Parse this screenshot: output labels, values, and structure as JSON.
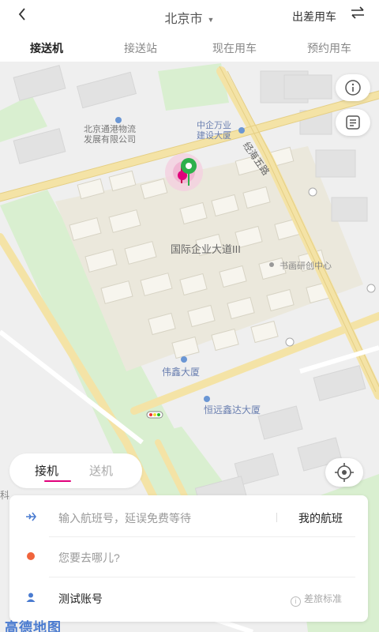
{
  "header": {
    "back_icon": "chevron-left-icon",
    "city": "北京市",
    "business_trip": "出差用车",
    "swap_icon": "swap-icon"
  },
  "tabs": [
    {
      "label": "接送机",
      "active": true
    },
    {
      "label": "接送站",
      "active": false
    },
    {
      "label": "现在用车",
      "active": false
    },
    {
      "label": "预约用车",
      "active": false
    }
  ],
  "map": {
    "labels": {
      "company1": [
        "北京通港物流",
        "发展有限公司"
      ],
      "company2": [
        "中企万业",
        "建设大厦"
      ],
      "road": "经海五路",
      "plaza": "国际企业大道III",
      "center": "书画研创中心",
      "weixin": "伟鑫大厦",
      "hengyuan": "恒远鑫达大厦",
      "edge": "科"
    },
    "brand_logo": "高德地图"
  },
  "mode_tabs": [
    {
      "label": "接机",
      "active": true
    },
    {
      "label": "送机",
      "active": false
    }
  ],
  "form": {
    "flight_placeholder": "输入航班号，延误免费等待",
    "my_flight": "我的航班",
    "destination_placeholder": "您要去哪儿?",
    "account": "测试账号",
    "travel_standard": "差旅标准"
  },
  "colors": {
    "accent": "#e0007a",
    "pin": "#2db04b",
    "destination_dot": "#f0643c",
    "flight_icon": "#4a7bd0"
  }
}
